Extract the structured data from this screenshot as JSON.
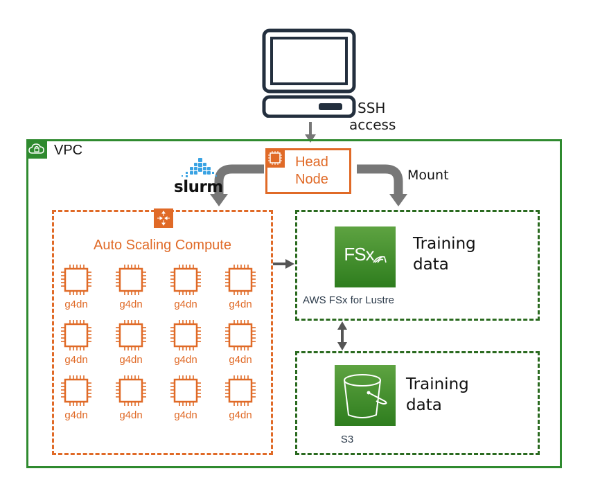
{
  "client": {
    "icon": "desktop-computer-icon",
    "label_line1": "SSH",
    "label_line2": "access"
  },
  "vpc": {
    "icon": "cloud-lock-icon",
    "label": "VPC",
    "color": "#2f8a2f"
  },
  "head_node": {
    "icon": "ec2-instance-icon",
    "label_line1": "Head",
    "label_line2": "Node",
    "color": "#e06a27"
  },
  "slurm": {
    "logo_text": "slurm",
    "accent": "#3aa3e3"
  },
  "mount": {
    "label": "Mount"
  },
  "compute": {
    "icon": "auto-scaling-icon",
    "label": "Auto Scaling Compute",
    "color": "#e06a27",
    "instances": [
      {
        "label": "g4dn"
      },
      {
        "label": "g4dn"
      },
      {
        "label": "g4dn"
      },
      {
        "label": "g4dn"
      },
      {
        "label": "g4dn"
      },
      {
        "label": "g4dn"
      },
      {
        "label": "g4dn"
      },
      {
        "label": "g4dn"
      },
      {
        "label": "g4dn"
      },
      {
        "label": "g4dn"
      },
      {
        "label": "g4dn"
      },
      {
        "label": "g4dn"
      }
    ]
  },
  "fsx": {
    "icon": "fsx-lustre-icon",
    "icon_text": "FSx",
    "caption": "AWS FSx for Lustre",
    "note_line1": "Training",
    "note_line2": "data",
    "color": "#2a6a1f"
  },
  "s3": {
    "icon": "s3-bucket-icon",
    "caption": "S3",
    "note_line1": "Training",
    "note_line2": "data"
  }
}
